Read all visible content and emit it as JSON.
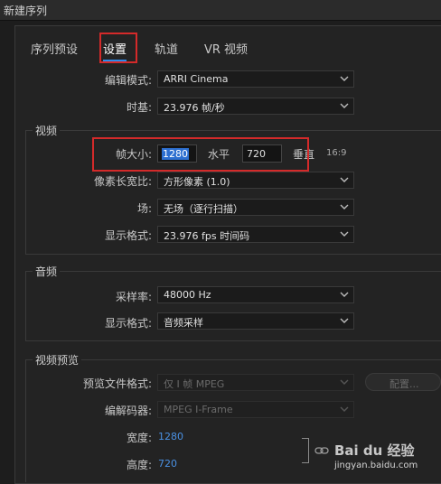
{
  "window": {
    "title": "新建序列"
  },
  "tabs": [
    {
      "label": "序列预设"
    },
    {
      "label": "设置"
    },
    {
      "label": "轨道"
    },
    {
      "label": "VR 视频"
    }
  ],
  "settings": {
    "editing_mode_label": "编辑模式:",
    "editing_mode_value": "ARRI Cinema",
    "timebase_label": "时基:",
    "timebase_value": "23.976  帧/秒"
  },
  "video": {
    "section_title": "视频",
    "frame_size_label": "帧大小:",
    "frame_width": "1280",
    "horizontal_label": "水平",
    "frame_height": "720",
    "vertical_label": "垂直",
    "aspect_ratio": "16:9",
    "pixel_aspect_label": "像素长宽比:",
    "pixel_aspect_value": "方形像素 (1.0)",
    "fields_label": "场:",
    "fields_value": "无场（逐行扫描）",
    "display_format_label": "显示格式:",
    "display_format_value": "23.976 fps 时间码"
  },
  "audio": {
    "section_title": "音频",
    "sample_rate_label": "采样率:",
    "sample_rate_value": "48000 Hz",
    "display_format_label": "显示格式:",
    "display_format_value": "音频采样"
  },
  "preview": {
    "section_title": "视频预览",
    "file_format_label": "预览文件格式:",
    "file_format_value": "仅 I 帧 MPEG",
    "configure_label": "配置...",
    "codec_label": "编解码器:",
    "codec_value": "MPEG I-Frame",
    "width_label": "宽度:",
    "width_value": "1280",
    "height_label": "高度:",
    "height_value": "720"
  },
  "watermark": {
    "logo": "Bai du 经验",
    "url": "jingyan.baidu.com"
  },
  "colors": {
    "accent": "#2d8ceb",
    "highlight_box": "#d42a2a",
    "link_value": "#4a90e2"
  }
}
